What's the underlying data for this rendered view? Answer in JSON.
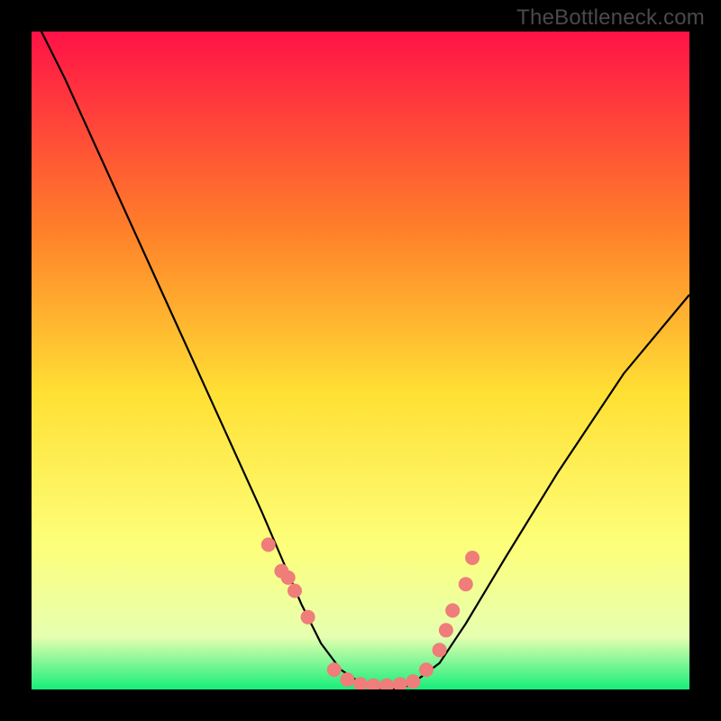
{
  "watermark": "TheBottleneck.com",
  "colors": {
    "frame": "#000000",
    "curve": "#000000",
    "dot_fill": "#ef7d79",
    "grad_top": "#ff1247",
    "grad_mid_upper": "#ff7f2a",
    "grad_mid": "#ffe034",
    "grad_mid_lower": "#fdff7a",
    "grad_lower": "#e6ffb0",
    "grad_bottom": "#16ee7a"
  },
  "chart_data": {
    "type": "line",
    "title": "",
    "xlabel": "",
    "ylabel": "",
    "xlim": [
      0,
      100
    ],
    "ylim": [
      0,
      100
    ],
    "series": [
      {
        "name": "bottleneck-curve",
        "x": [
          0,
          5,
          10,
          15,
          20,
          25,
          30,
          35,
          38,
          41,
          44,
          47,
          50,
          53,
          56,
          58,
          62,
          66,
          72,
          80,
          90,
          100
        ],
        "y": [
          103,
          93,
          82,
          71,
          60,
          49,
          38,
          27,
          20,
          13,
          7,
          3,
          1,
          0,
          0,
          1,
          4,
          10,
          20,
          33,
          48,
          60
        ]
      }
    ],
    "dots": {
      "name": "highlight-points",
      "x": [
        36,
        38,
        39,
        40,
        42,
        46,
        48,
        50,
        52,
        54,
        56,
        58,
        60,
        62,
        63,
        64,
        66,
        67
      ],
      "y": [
        22,
        18,
        17,
        15,
        11,
        3,
        1.5,
        0.8,
        0.6,
        0.6,
        0.8,
        1.2,
        3,
        6,
        9,
        12,
        16,
        20
      ]
    }
  }
}
